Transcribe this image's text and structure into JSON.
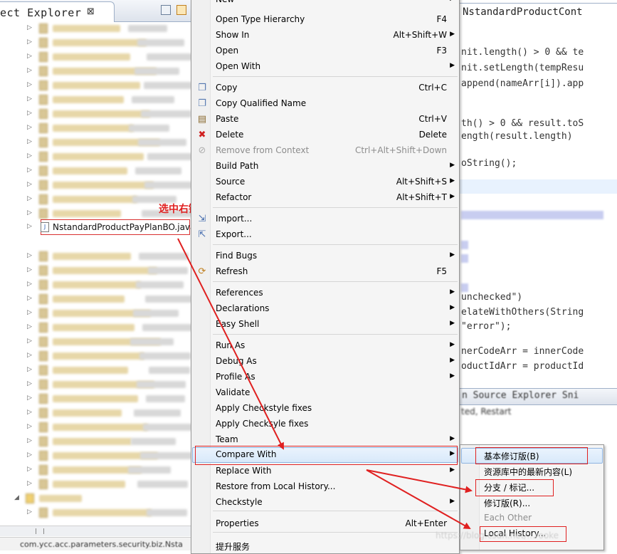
{
  "explorer": {
    "title": "ect Explorer",
    "close_glyph": "⊠",
    "selected_file": "NstandardProductPayPlanBO.java",
    "annotation": "选中右键",
    "status_text": "com.ycc.acc.parameters.security.biz.Nsta"
  },
  "editor": {
    "tab_title": "NstandardProductCont",
    "code_lines": [
      "nit.length() > 0 && te",
      "nit.setLength(tempResu",
      "append(nameArr[i]).app",
      "th() > 0 && result.toS",
      "ength(result.length)",
      "oString();",
      "unchecked\")",
      "elateWithOthers(String",
      "\"error\");",
      "nerCodeArr = innerCode",
      "oductIdArr = productId"
    ],
    "bottom_tabs": "n Source Explorer  Sni"
  },
  "context_menu": {
    "items": [
      {
        "label": "New",
        "shortcut": "",
        "submenu": true,
        "icon": ""
      },
      {
        "label": "Open Type Hierarchy",
        "shortcut": "F4",
        "submenu": false,
        "icon": ""
      },
      {
        "label": "Show In",
        "shortcut": "Alt+Shift+W",
        "submenu": true,
        "icon": ""
      },
      {
        "label": "Open",
        "shortcut": "F3",
        "submenu": false,
        "icon": ""
      },
      {
        "label": "Open With",
        "shortcut": "",
        "submenu": true,
        "icon": ""
      },
      {
        "label": "Copy",
        "shortcut": "Ctrl+C",
        "submenu": false,
        "icon": "copy-icon"
      },
      {
        "label": "Copy Qualified Name",
        "shortcut": "",
        "submenu": false,
        "icon": "copy-qualified-icon"
      },
      {
        "label": "Paste",
        "shortcut": "Ctrl+V",
        "submenu": false,
        "icon": "paste-icon"
      },
      {
        "label": "Delete",
        "shortcut": "Delete",
        "submenu": false,
        "icon": "delete-icon"
      },
      {
        "label": "Remove from Context",
        "shortcut": "Ctrl+Alt+Shift+Down",
        "submenu": false,
        "icon": "remove-context-icon",
        "disabled": true
      },
      {
        "label": "Build Path",
        "shortcut": "",
        "submenu": true,
        "icon": ""
      },
      {
        "label": "Source",
        "shortcut": "Alt+Shift+S",
        "submenu": true,
        "icon": ""
      },
      {
        "label": "Refactor",
        "shortcut": "Alt+Shift+T",
        "submenu": true,
        "icon": ""
      },
      {
        "label": "Import...",
        "shortcut": "",
        "submenu": false,
        "icon": "import-icon"
      },
      {
        "label": "Export...",
        "shortcut": "",
        "submenu": false,
        "icon": "export-icon"
      },
      {
        "label": "Find Bugs",
        "shortcut": "",
        "submenu": true,
        "icon": ""
      },
      {
        "label": "Refresh",
        "shortcut": "F5",
        "submenu": false,
        "icon": "refresh-icon"
      },
      {
        "label": "References",
        "shortcut": "",
        "submenu": true,
        "icon": ""
      },
      {
        "label": "Declarations",
        "shortcut": "",
        "submenu": true,
        "icon": ""
      },
      {
        "label": "Easy Shell",
        "shortcut": "",
        "submenu": true,
        "icon": ""
      },
      {
        "label": "Run As",
        "shortcut": "",
        "submenu": true,
        "icon": ""
      },
      {
        "label": "Debug As",
        "shortcut": "",
        "submenu": true,
        "icon": ""
      },
      {
        "label": "Profile As",
        "shortcut": "",
        "submenu": true,
        "icon": ""
      },
      {
        "label": "Validate",
        "shortcut": "",
        "submenu": false,
        "icon": ""
      },
      {
        "label": "Apply Checkstyle fixes",
        "shortcut": "",
        "submenu": false,
        "icon": ""
      },
      {
        "label": "Apply Checksyle fixes",
        "shortcut": "",
        "submenu": false,
        "icon": ""
      },
      {
        "label": "Team",
        "shortcut": "",
        "submenu": true,
        "icon": ""
      },
      {
        "label": "Compare With",
        "shortcut": "",
        "submenu": true,
        "icon": "",
        "highlighted": true
      },
      {
        "label": "Replace With",
        "shortcut": "",
        "submenu": true,
        "icon": ""
      },
      {
        "label": "Restore from Local History...",
        "shortcut": "",
        "submenu": false,
        "icon": ""
      },
      {
        "label": "Checkstyle",
        "shortcut": "",
        "submenu": true,
        "icon": ""
      },
      {
        "label": "Properties",
        "shortcut": "Alt+Enter",
        "submenu": false,
        "icon": ""
      },
      {
        "label": "提升服务",
        "shortcut": "",
        "submenu": false,
        "icon": ""
      }
    ]
  },
  "compare_submenu": {
    "items": [
      {
        "label": "基本修订版(B)",
        "highlighted": true
      },
      {
        "label": "资源库中的最新内容(L)"
      },
      {
        "label": "分支 / 标记..."
      },
      {
        "label": "修订版(R)..."
      },
      {
        "label": "Each Other",
        "disabled": true
      },
      {
        "label": "Local History..."
      }
    ]
  },
  "watermark": "https://blog.csdn.net/...rooke"
}
